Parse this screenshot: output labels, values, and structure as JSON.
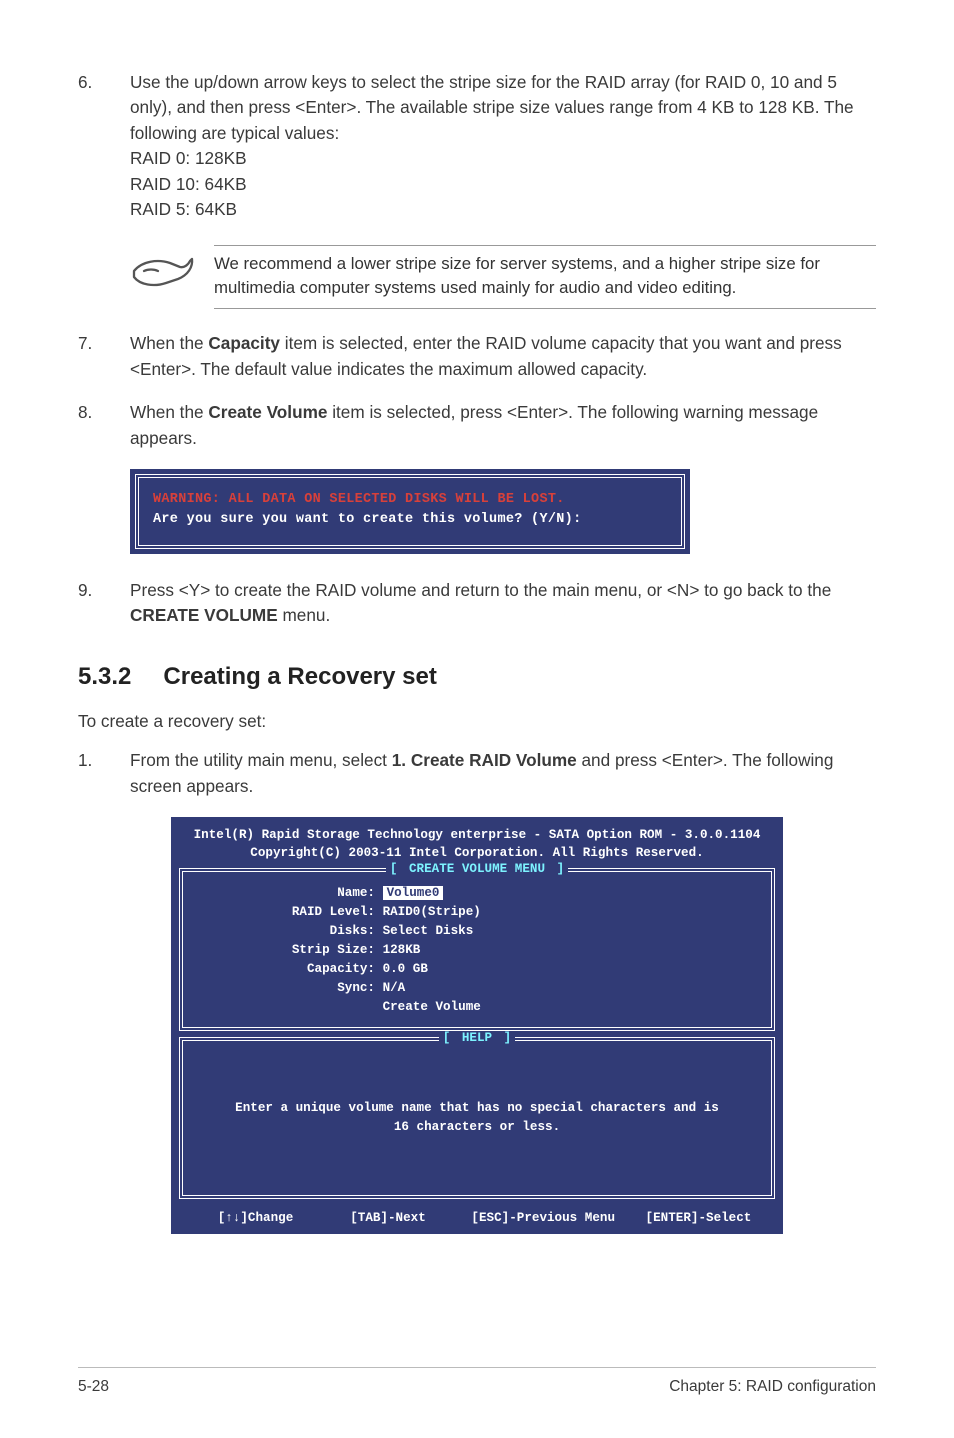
{
  "step6": {
    "num": "6.",
    "text_a": "Use the up/down arrow keys to select the stripe size for the RAID array (for RAID 0, 10 and 5 only), and then press <Enter>. The available stripe size values range from 4 KB to 128 KB. The following are typical values:",
    "lines": [
      "RAID 0: 128KB",
      "RAID 10: 64KB",
      "RAID 5: 64KB"
    ]
  },
  "note": "We recommend a lower stripe size for server systems, and a higher stripe size for multimedia computer systems used mainly for audio and video editing.",
  "step7": {
    "num": "7.",
    "text_a": "When the ",
    "bold_a": "Capacity",
    "text_b": " item is selected, enter the RAID volume capacity that you want and press <Enter>. The default value indicates the maximum allowed capacity."
  },
  "step8": {
    "num": "8.",
    "text_a": "When the ",
    "bold_a": "Create Volume",
    "text_b": " item is selected, press <Enter>. The following warning message appears."
  },
  "warning": {
    "line1": "WARNING: ALL DATA ON SELECTED DISKS WILL BE LOST.",
    "line2": "Are you sure you want to create this volume? (Y/N):"
  },
  "step9": {
    "num": "9.",
    "text_a": "Press <Y> to create the RAID volume and return to the main menu, or <N> to go back to the ",
    "bold_a": "CREATE VOLUME",
    "text_b": " menu."
  },
  "section": {
    "num": "5.3.2",
    "title": "Creating a Recovery set"
  },
  "intro": "To create a recovery set:",
  "step1": {
    "num": "1.",
    "text_a": "From the utility main menu, select ",
    "bold_a": "1. Create RAID Volume",
    "text_b": " and press <Enter>. The following screen appears."
  },
  "bios": {
    "header_l1": "Intel(R) Rapid Storage Technology enterprise - SATA Option ROM - 3.0.0.1104",
    "header_l2": "Copyright(C) 2003-11 Intel Corporation.  All Rights Reserved.",
    "panel1_title": "CREATE VOLUME MENU",
    "fields": [
      {
        "label": "Name:",
        "value": "Volume0",
        "inv": true
      },
      {
        "label": "RAID Level:",
        "value": "RAID0(Stripe)",
        "inv": false
      },
      {
        "label": "Disks:",
        "value": "Select Disks",
        "inv": false
      },
      {
        "label": "Strip Size:",
        "value": "128KB",
        "inv": false
      },
      {
        "label": "Capacity:",
        "value": "0.0   GB",
        "inv": false
      },
      {
        "label": "Sync:",
        "value": "N/A",
        "inv": false
      },
      {
        "label": "",
        "value": "Create Volume",
        "inv": false
      }
    ],
    "panel2_title": "HELP",
    "help_l1": "Enter a unique volume name that has no special characters and is",
    "help_l2": "16 characters or less.",
    "footer": {
      "change": "[↑↓]Change",
      "next": "[TAB]-Next",
      "prev": "[ESC]-Previous Menu",
      "select": "[ENTER]-Select"
    }
  },
  "pagefoot": {
    "left": "5-28",
    "right": "Chapter 5: RAID configuration"
  }
}
